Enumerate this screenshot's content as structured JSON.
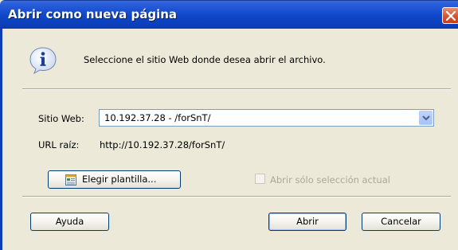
{
  "window": {
    "title": "Abrir como nueva página"
  },
  "info": {
    "message": "Seleccione el sitio Web donde desea abrir el archivo.",
    "icon": "info-icon"
  },
  "site": {
    "label": "Sitio Web:",
    "value": "10.192.37.28 - /forSnT/"
  },
  "url": {
    "label": "URL raíz:",
    "value": "http://10.192.37.28/forSnT/"
  },
  "template_button": {
    "label": "Elegir plantilla..."
  },
  "selection_checkbox": {
    "label": "Abrir sólo selección actual",
    "checked": false,
    "enabled": false
  },
  "buttons": {
    "help": "Ayuda",
    "open": "Abrir",
    "cancel": "Cancelar"
  }
}
